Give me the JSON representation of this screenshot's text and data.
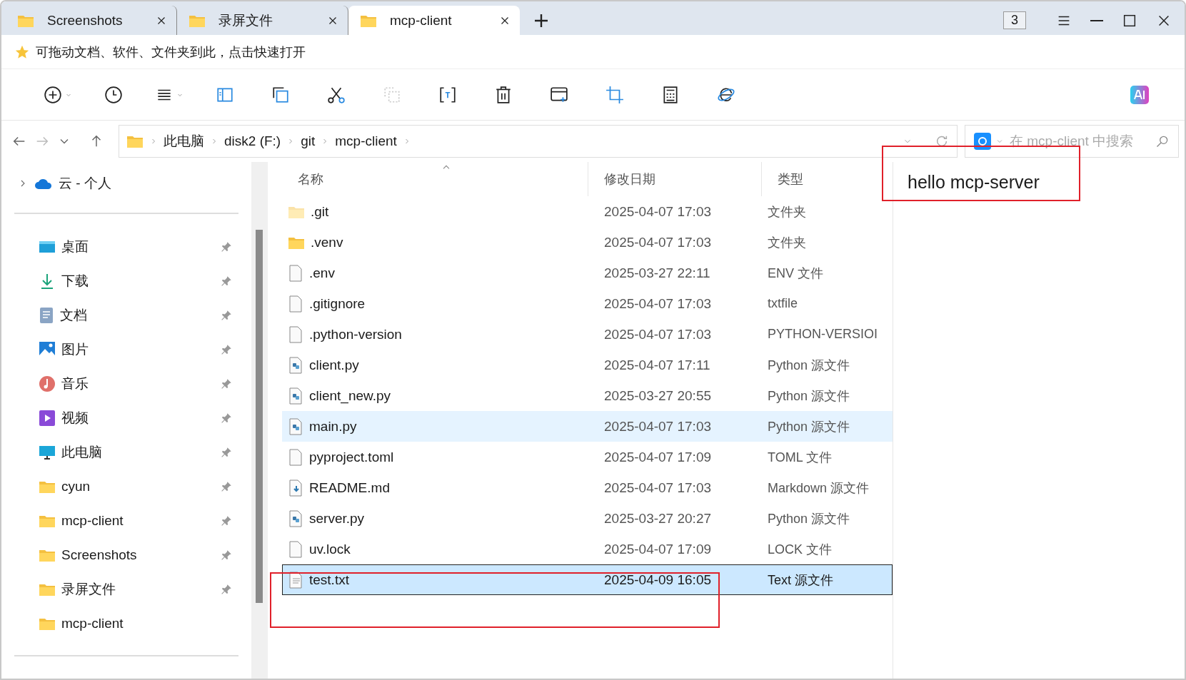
{
  "tabs": [
    {
      "label": "Screenshots",
      "selected": false
    },
    {
      "label": "录屏文件",
      "selected": false
    },
    {
      "label": "mcp-client",
      "selected": true
    }
  ],
  "tab_count": "3",
  "favorites_bar": "可拖动文档、软件、文件夹到此，点击快速打开",
  "address": {
    "segments": [
      "此电脑",
      "disk2 (F:)",
      "git",
      "mcp-client"
    ]
  },
  "search": {
    "placeholder": "在 mcp-client 中搜索"
  },
  "sidebar": {
    "cloud": {
      "label": "云 - 个人",
      "expanded": false
    },
    "items": [
      {
        "label": "桌面",
        "kind": "desktop",
        "pinned": true
      },
      {
        "label": "下载",
        "kind": "download",
        "pinned": true
      },
      {
        "label": "文档",
        "kind": "documents",
        "pinned": true
      },
      {
        "label": "图片",
        "kind": "pictures",
        "pinned": true
      },
      {
        "label": "音乐",
        "kind": "music",
        "pinned": true
      },
      {
        "label": "视频",
        "kind": "videos",
        "pinned": true
      },
      {
        "label": "此电脑",
        "kind": "pc",
        "pinned": true
      },
      {
        "label": "cyun",
        "kind": "folder",
        "pinned": true
      },
      {
        "label": "mcp-client",
        "kind": "folder",
        "pinned": true
      },
      {
        "label": "Screenshots",
        "kind": "folder",
        "pinned": true
      },
      {
        "label": "录屏文件",
        "kind": "folder",
        "pinned": true
      },
      {
        "label": "mcp-client",
        "kind": "folder",
        "pinned": false
      }
    ]
  },
  "columns": [
    "名称",
    "修改日期",
    "类型"
  ],
  "rows": [
    {
      "name": ".git",
      "modified": "2025-04-07 17:03",
      "type": "文件夹",
      "kind": "folder",
      "hidden": true,
      "hovered": false,
      "selected": false
    },
    {
      "name": ".venv",
      "modified": "2025-04-07 17:03",
      "type": "文件夹",
      "kind": "folder",
      "hidden": false,
      "hovered": false,
      "selected": false
    },
    {
      "name": ".env",
      "modified": "2025-03-27 22:11",
      "type": "ENV 文件",
      "kind": "file",
      "hidden": false,
      "hovered": false,
      "selected": false
    },
    {
      "name": ".gitignore",
      "modified": "2025-04-07 17:03",
      "type": "txtfile",
      "kind": "file",
      "hidden": false,
      "hovered": false,
      "selected": false
    },
    {
      "name": ".python-version",
      "modified": "2025-04-07 17:03",
      "type": "PYTHON-VERSIOI",
      "kind": "file",
      "hidden": false,
      "hovered": false,
      "selected": false
    },
    {
      "name": "client.py",
      "modified": "2025-04-07 17:11",
      "type": "Python 源文件",
      "kind": "python",
      "hidden": false,
      "hovered": false,
      "selected": false
    },
    {
      "name": "client_new.py",
      "modified": "2025-03-27 20:55",
      "type": "Python 源文件",
      "kind": "python",
      "hidden": false,
      "hovered": false,
      "selected": false
    },
    {
      "name": "main.py",
      "modified": "2025-04-07 17:03",
      "type": "Python 源文件",
      "kind": "python",
      "hidden": false,
      "hovered": true,
      "selected": false
    },
    {
      "name": "pyproject.toml",
      "modified": "2025-04-07 17:09",
      "type": "TOML 文件",
      "kind": "file",
      "hidden": false,
      "hovered": false,
      "selected": false
    },
    {
      "name": "README.md",
      "modified": "2025-04-07 17:03",
      "type": "Markdown 源文件",
      "kind": "markdown",
      "hidden": false,
      "hovered": false,
      "selected": false
    },
    {
      "name": "server.py",
      "modified": "2025-03-27 20:27",
      "type": "Python 源文件",
      "kind": "python",
      "hidden": false,
      "hovered": false,
      "selected": false
    },
    {
      "name": "uv.lock",
      "modified": "2025-04-07 17:09",
      "type": "LOCK 文件",
      "kind": "file",
      "hidden": false,
      "hovered": false,
      "selected": false
    },
    {
      "name": "test.txt",
      "modified": "2025-04-09 16:05",
      "type": "Text 源文件",
      "kind": "text",
      "hidden": false,
      "hovered": false,
      "selected": true
    }
  ],
  "preview": {
    "text": "hello mcp-server"
  }
}
